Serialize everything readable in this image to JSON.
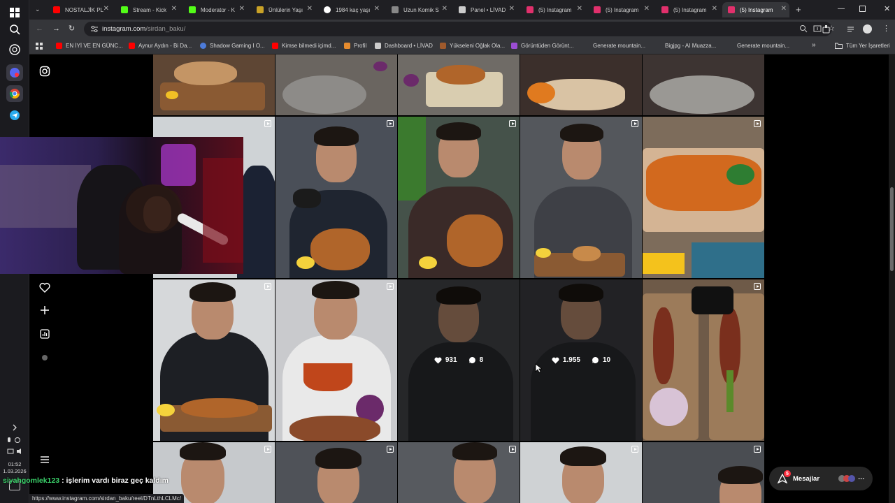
{
  "browser": {
    "tabs": [
      {
        "title": "NOSTALJİK PL",
        "color": "#ff0000"
      },
      {
        "title": "Stream - Kick",
        "color": "#53fc18"
      },
      {
        "title": "Moderator - K",
        "color": "#53fc18"
      },
      {
        "title": "Ünlülerin Yaşı",
        "color": "#c9a227"
      },
      {
        "title": "1984 kaç yaşı",
        "color": "#ffffff"
      },
      {
        "title": "Uzun Komik S",
        "color": "#888888"
      },
      {
        "title": "Panel • LİVAD",
        "color": "#cccccc"
      },
      {
        "title": "(5) Instagram",
        "color": "#e1306c"
      },
      {
        "title": "(5) Instagram",
        "color": "#e1306c"
      },
      {
        "title": "(5) Instagram",
        "color": "#e1306c"
      },
      {
        "title": "(5) Instagram",
        "color": "#e1306c"
      }
    ],
    "new_tab": "+",
    "url_host": "instagram.com",
    "url_path": "/sirdan_baku/",
    "bookmarks": [
      {
        "label": "EN İYİ VE EN GÜNC...",
        "color": "#ff0000"
      },
      {
        "label": "Aynur Aydın - Bi Da...",
        "color": "#ff0000"
      },
      {
        "label": "Shadow Gaming I O...",
        "color": "#4c7bd9"
      },
      {
        "label": "Kimse bilmedi içimd...",
        "color": "#ff0000"
      },
      {
        "label": "Profil",
        "color": "#e58b2e"
      },
      {
        "label": "Dashboard • LİVAD",
        "color": "#cccccc"
      },
      {
        "label": "Yükseleni Oğlak Ola...",
        "color": "#a05a2c"
      },
      {
        "label": "Görüntüden Görünt...",
        "color": "#9b4dd3"
      },
      {
        "label": "Generate mountain...",
        "color": ""
      },
      {
        "label": "Bigjpg - AI Muazza...",
        "color": ""
      },
      {
        "label": "Generate mountain...",
        "color": ""
      }
    ],
    "all_bookmarks": "Tüm Yer İşaretleri",
    "more_bookmarks": "»"
  },
  "grid": {
    "hover_posts": [
      {
        "likes": "931",
        "comments": "8"
      },
      {
        "likes": "1.955",
        "comments": "10"
      }
    ]
  },
  "messages": {
    "label": "Mesajlar",
    "badge": "5"
  },
  "chat": {
    "user": "siyahgomlek123",
    "message": ": işlerim vardı biraz geç kaldım"
  },
  "status_url": "https://www.instagram.com/sirdan_baku/reel/DTnLthLCLMc/",
  "clock": {
    "time": "01:52",
    "date": "1.03.2026"
  }
}
